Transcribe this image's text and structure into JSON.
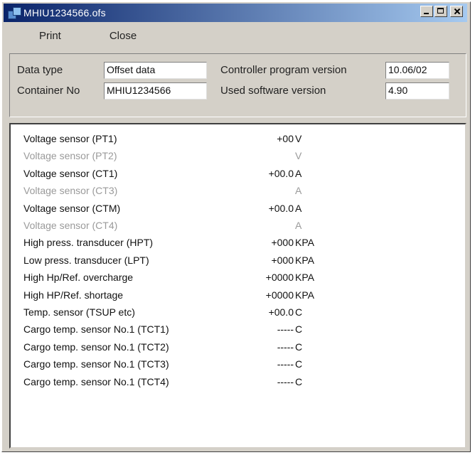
{
  "window": {
    "title": "MHIU1234566.ofs"
  },
  "menu": {
    "print": "Print",
    "close": "Close"
  },
  "info": {
    "data_type_label": "Data type",
    "data_type_value": "Offset data",
    "container_no_label": "Container No",
    "container_no_value": "MHIU1234566",
    "controller_version_label": "Controller program version",
    "controller_version_value": "10.06/02",
    "software_version_label": "Used software version",
    "software_version_value": "4.90"
  },
  "rows": [
    {
      "name": "Voltage sensor (PT1)",
      "value": "+00",
      "unit": "V",
      "state": "active"
    },
    {
      "name": "Voltage sensor (PT2)",
      "value": "",
      "unit": "V",
      "state": "inactive"
    },
    {
      "name": "Voltage sensor (CT1)",
      "value": "+00.0",
      "unit": "A",
      "state": "active"
    },
    {
      "name": "Voltage sensor (CT3)",
      "value": "",
      "unit": "A",
      "state": "inactive"
    },
    {
      "name": "Voltage sensor (CTM)",
      "value": "+00.0",
      "unit": "A",
      "state": "active"
    },
    {
      "name": "Voltage sensor (CT4)",
      "value": "",
      "unit": "A",
      "state": "inactive"
    },
    {
      "name": "High press. transducer (HPT)",
      "value": "+000",
      "unit": "KPA",
      "state": "active"
    },
    {
      "name": "Low press. transducer (LPT)",
      "value": "+000",
      "unit": "KPA",
      "state": "active"
    },
    {
      "name": "High Hp/Ref. overcharge",
      "value": "+0000",
      "unit": "KPA",
      "state": "active"
    },
    {
      "name": "High HP/Ref. shortage",
      "value": "+0000",
      "unit": "KPA",
      "state": "active"
    },
    {
      "name": "Temp. sensor (TSUP etc)",
      "value": "+00.0",
      "unit": "C",
      "state": "active"
    },
    {
      "name": "Cargo temp. sensor No.1 (TCT1)",
      "value": "-----",
      "unit": "C",
      "state": "active"
    },
    {
      "name": "Cargo temp. sensor No.1 (TCT2)",
      "value": "-----",
      "unit": "C",
      "state": "active"
    },
    {
      "name": "Cargo temp. sensor No.1 (TCT3)",
      "value": "-----",
      "unit": "C",
      "state": "active"
    },
    {
      "name": "Cargo temp. sensor No.1 (TCT4)",
      "value": "-----",
      "unit": "C",
      "state": "active"
    }
  ]
}
